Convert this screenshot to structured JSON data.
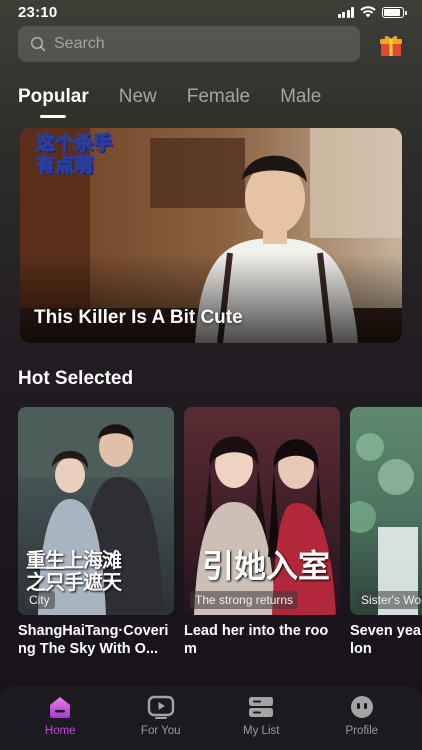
{
  "status_bar": {
    "time": "23:10",
    "battery_level": 0.9
  },
  "search": {
    "placeholder": "Search"
  },
  "tabs": [
    {
      "label": "Popular",
      "active": true
    },
    {
      "label": "New",
      "active": false
    },
    {
      "label": "Female",
      "active": false
    },
    {
      "label": "Male",
      "active": false
    }
  ],
  "banner": {
    "title": "This Killer Is A Bit Cute",
    "logo_text": "这个杀手\n有点萌"
  },
  "hot_selected": {
    "title": "Hot Selected",
    "items": [
      {
        "title": "ShangHaiTang·Covering The Sky With O...",
        "tag": "City",
        "poster_text": "重生上海滩\n之只手遮天"
      },
      {
        "title": "Lead her into the room",
        "tag": "The strong returns",
        "poster_text": "引她入室"
      },
      {
        "title": "Seven years, a love, a lon",
        "tag": "Sister's Wo",
        "poster_text": ""
      }
    ]
  },
  "bottom_nav": [
    {
      "label": "Home",
      "icon": "home-icon",
      "active": true
    },
    {
      "label": "For You",
      "icon": "play-icon",
      "active": false
    },
    {
      "label": "My List",
      "icon": "list-icon",
      "active": false
    },
    {
      "label": "Profile",
      "icon": "profile-icon",
      "active": false
    }
  ],
  "colors": {
    "accent": "#c24bd7",
    "background": "#1b161d",
    "gift": "#f2a623"
  }
}
